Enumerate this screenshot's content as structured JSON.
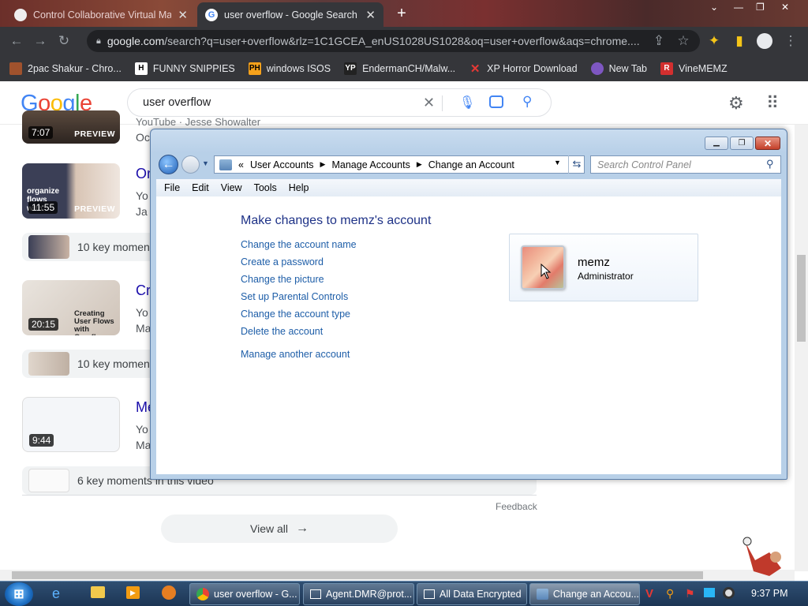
{
  "browser": {
    "tabs": [
      {
        "title": "Control Collaborative Virtual Ma",
        "active": false
      },
      {
        "title": "user overflow - Google Search",
        "active": true
      }
    ],
    "url_host": "google.com",
    "url_rest": "/search?q=user+overflow&rlz=1C1GCEA_enUS1028US1028&oq=user+overflow&aqs=chrome....",
    "bookmarks": [
      "2pac Shakur - Chro...",
      "FUNNY SNIPPIES",
      "windows ISOS",
      "EndermanCH/Malw...",
      "XP Horror Download",
      "New Tab",
      "VineMEMZ"
    ]
  },
  "google": {
    "logo": "Google",
    "query": "user overflow",
    "results": [
      {
        "duration": "7:07",
        "preview": "PREVIEW",
        "title": "",
        "source": "YouTube · Jesse Showalter",
        "date": "Oc"
      },
      {
        "duration": "11:55",
        "preview": "PREVIEW",
        "title": "Or",
        "source": "Yo",
        "date": "Ja",
        "thumb_text": "organize flows with"
      },
      {
        "duration": "20:15",
        "preview": "",
        "title": "Cr",
        "source": "Yo",
        "date": "Ma",
        "thumb_text": "Creating User Flows with Overflow"
      },
      {
        "duration": "9:44",
        "preview": "",
        "title": "Me",
        "source": "Yo",
        "date": "Ma"
      }
    ],
    "key_moments": [
      "10 key moment",
      "10 key moment",
      "6 key moments in this video"
    ],
    "feedback": "Feedback",
    "view_all": "View all"
  },
  "control_panel": {
    "breadcrumb": [
      "User Accounts",
      "Manage Accounts",
      "Change an Account"
    ],
    "search_placeholder": "Search Control Panel",
    "menu": [
      "File",
      "Edit",
      "View",
      "Tools",
      "Help"
    ],
    "heading": "Make changes to memz's account",
    "links": [
      "Change the account name",
      "Create a password",
      "Change the picture",
      "Set up Parental Controls",
      "Change the account type",
      "Delete the account"
    ],
    "manage_other": "Manage another account",
    "account_name": "memz",
    "account_type": "Administrator"
  },
  "taskbar": {
    "buttons": [
      "user overflow - G...",
      "Agent.DMR@prot...",
      "All Data Encrypted",
      "Change an Accou..."
    ],
    "clock": "9:37 PM"
  }
}
